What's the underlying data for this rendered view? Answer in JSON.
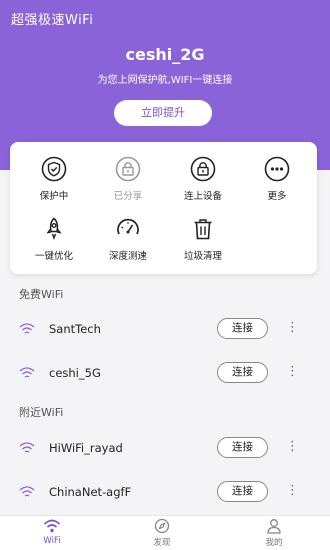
{
  "header": {
    "app_title": "超强极速WiFi",
    "ssid": "ceshi_2G",
    "subtitle": "为您上网保护航,WIFI一键连接",
    "cta_label": "立即提升"
  },
  "tools": [
    {
      "label": "保护中",
      "icon": "shield-check-icon"
    },
    {
      "label": "已分享",
      "icon": "lock-icon",
      "muted": true
    },
    {
      "label": "连上设备",
      "icon": "lock-icon"
    },
    {
      "label": "更多",
      "icon": "more-dots-icon"
    },
    {
      "label": "一键优化",
      "icon": "rocket-icon"
    },
    {
      "label": "深度测速",
      "icon": "speedometer-icon"
    },
    {
      "label": "垃圾清理",
      "icon": "trash-icon"
    }
  ],
  "free_wifi": {
    "title": "免费WiFi",
    "items": [
      {
        "name": "SantTech",
        "action": "连接"
      },
      {
        "name": "ceshi_5G",
        "action": "连接"
      }
    ]
  },
  "nearby_wifi": {
    "title": "附近WiFi",
    "items": [
      {
        "name": "HiWiFi_rayad",
        "action": "连接"
      },
      {
        "name": "ChinaNet-agfF",
        "action": "连接"
      }
    ]
  },
  "tabbar": {
    "tabs": [
      {
        "label": "WiFi",
        "icon": "wifi-icon",
        "active": true
      },
      {
        "label": "发现",
        "icon": "compass-icon"
      },
      {
        "label": "我的",
        "icon": "user-icon"
      }
    ]
  },
  "colors": {
    "accent": "#8a63d8",
    "accent_text": "#7a52cf",
    "background": "#f4f4f6"
  }
}
